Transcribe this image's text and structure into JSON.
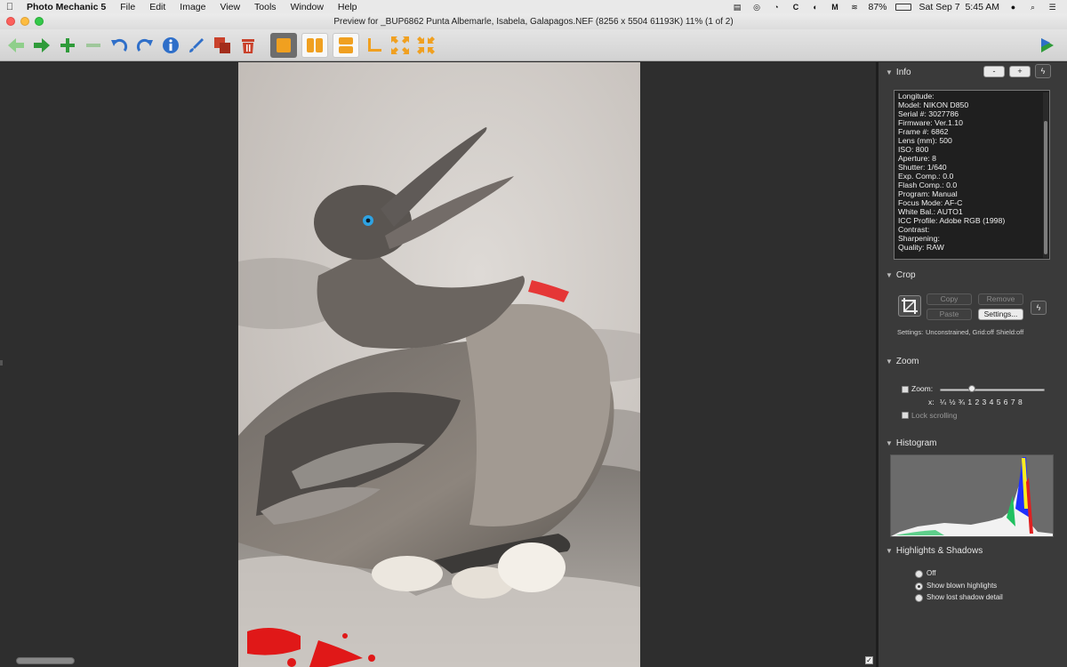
{
  "menubar": {
    "app_name": "Photo Mechanic 5",
    "menus": [
      "File",
      "Edit",
      "Image",
      "View",
      "Tools",
      "Window",
      "Help"
    ],
    "battery": "87%",
    "datetime": "Sat Sep 7  5:45 AM"
  },
  "window": {
    "title": "Preview for _BUP6862 Punta Albemarle, Isabela, Galapagos.NEF (8256 x 5504 61193K) 11% (1 of 2)"
  },
  "toolbar": {
    "buttons": [
      {
        "name": "previous-arrow-icon",
        "color": "#8fcf8b"
      },
      {
        "name": "next-arrow-icon",
        "color": "#2f9b3a"
      },
      {
        "name": "zoom-in-plus-icon",
        "color": "#2f9b3a"
      },
      {
        "name": "zoom-out-minus-icon",
        "color": "#9fc79b"
      },
      {
        "name": "rotate-left-icon",
        "color": "#2f6fc9"
      },
      {
        "name": "rotate-right-icon",
        "color": "#2f6fc9"
      },
      {
        "name": "info-icon",
        "color": "#2f6fc9"
      },
      {
        "name": "edit-brush-icon",
        "color": "#2f6fc9"
      },
      {
        "name": "copy-icon",
        "color": "#c9412b"
      },
      {
        "name": "trash-icon",
        "color": "#c9412b"
      },
      {
        "name": "single-view-icon",
        "color": "#f0a020"
      },
      {
        "name": "side-by-side-icon",
        "color": "#f0a020"
      },
      {
        "name": "stacked-view-icon",
        "color": "#f0a020"
      },
      {
        "name": "crop-corner-icon",
        "color": "#f0a020"
      },
      {
        "name": "expand-icon",
        "color": "#f0a020"
      },
      {
        "name": "shrink-icon",
        "color": "#f0a020"
      }
    ]
  },
  "inspector": {
    "info": {
      "title": "Info",
      "btn_minus": "-",
      "btn_plus": "+",
      "lines": [
        "Longitude:",
        "Model: NIKON D850",
        "Serial #: 3027786",
        "Firmware: Ver.1.10",
        "Frame #: 6862",
        "Lens (mm): 500",
        "ISO: 800",
        "Aperture: 8",
        "Shutter: 1/640",
        "Exp. Comp.: 0.0",
        "Flash Comp.: 0.0",
        "Program: Manual",
        "Focus Mode: AF-C",
        "White Bal.: AUTO1",
        "ICC Profile: Adobe RGB (1998)",
        "Contrast:",
        "Sharpening:",
        "Quality: RAW"
      ]
    },
    "crop": {
      "title": "Crop",
      "copy": "Copy",
      "remove": "Remove",
      "paste": "Paste",
      "settings_btn": "Settings...",
      "settings_label": "Settings:",
      "settings_value": "Unconstrained, Grid:off Shield:off"
    },
    "zoom": {
      "title": "Zoom",
      "label": "Zoom:",
      "scale_prefix": "x:",
      "scale": "¼ ½ ¾ 1 2 3 4 5 6 7 8",
      "lock": "Lock scrolling"
    },
    "histogram": {
      "title": "Histogram"
    },
    "highlights": {
      "title": "Highlights & Shadows",
      "options": [
        "Off",
        "Show blown highlights",
        "Show lost shadow detail"
      ],
      "selected": 1
    }
  }
}
